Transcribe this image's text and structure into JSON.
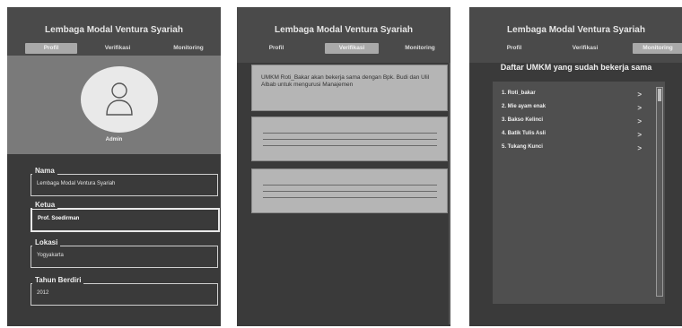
{
  "app": {
    "title": "Lembaga Modal Ventura Syariah"
  },
  "tabs": [
    "Profil",
    "Verifikasi",
    "Monitoring"
  ],
  "profile": {
    "avatar_label": "Admin",
    "fields": [
      {
        "label": "Nama",
        "value": "Lembaga Modal Ventura Syariah"
      },
      {
        "label": "Ketua",
        "value": "Prof. Soedirman"
      },
      {
        "label": "Lokasi",
        "value": "Yogyakarta"
      },
      {
        "label": "Tahun Berdiri",
        "value": "2012"
      }
    ]
  },
  "verifikasi": {
    "message": "UMKM Roti_Bakar akan bekerja sama dengan Bpk. Budi dan Ulil Albab untuk mengurusi Manajemen"
  },
  "monitoring": {
    "heading": "Daftar UMKM yang sudah bekerja sama",
    "items": [
      "1. Roti_bakar",
      "2. Mie ayam enak",
      "3. Bakso Kelinci",
      "4. Batik Tulis Asli",
      "5. Tukang Kunci"
    ],
    "chevron": ">"
  },
  "colors": {
    "screen_bg": "#3a3a3a",
    "header_bg": "#7a7a7a",
    "card_bg": "#b5b5b5"
  },
  "icons": {
    "avatar": "person-outline-icon",
    "chevron": "chevron-right-icon"
  }
}
